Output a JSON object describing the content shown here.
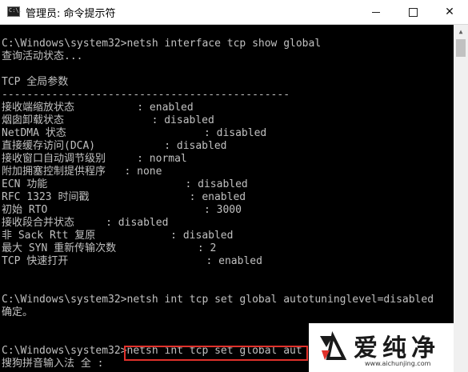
{
  "window": {
    "title": "管理员: 命令提示符",
    "icon_label": "C:\\.",
    "controls": {
      "minimize": "minimize-icon",
      "maximize": "maximize-icon",
      "close": "✕"
    }
  },
  "console": {
    "lines": [
      "",
      "C:\\Windows\\system32>netsh interface tcp show global",
      "查询活动状态...",
      "",
      "TCP 全局参数",
      "----------------------------------------------",
      "接收端缩放状态          : enabled",
      "烟囱卸载状态              : disabled",
      "NetDMA 状态                      : disabled",
      "直接缓存访问(DCA)           : disabled",
      "接收窗口自动调节级别     : normal",
      "附加拥塞控制提供程序   : none",
      "ECN 功能                      : disabled",
      "RFC 1323 时间戳                : enabled",
      "初始 RTO                         : 3000",
      "接收段合并状态     : disabled",
      "非 Sack Rtt 复原            : disabled",
      "最大 SYN 重新传输次数             : 2",
      "TCP 快速打开                      : enabled",
      "",
      "",
      "C:\\Windows\\system32>netsh int tcp set global autotuninglevel=disabled",
      "确定。",
      "",
      "",
      "C:\\Windows\\system32>netsh int tcp set global aut",
      "搜狗拼音输入法 全 :"
    ]
  },
  "watermark": {
    "text": "爱纯净",
    "url": "www.aichunjing.com"
  },
  "colors": {
    "console_bg": "#000000",
    "console_text": "#c0c0c0",
    "highlight_border": "#e0312b"
  }
}
